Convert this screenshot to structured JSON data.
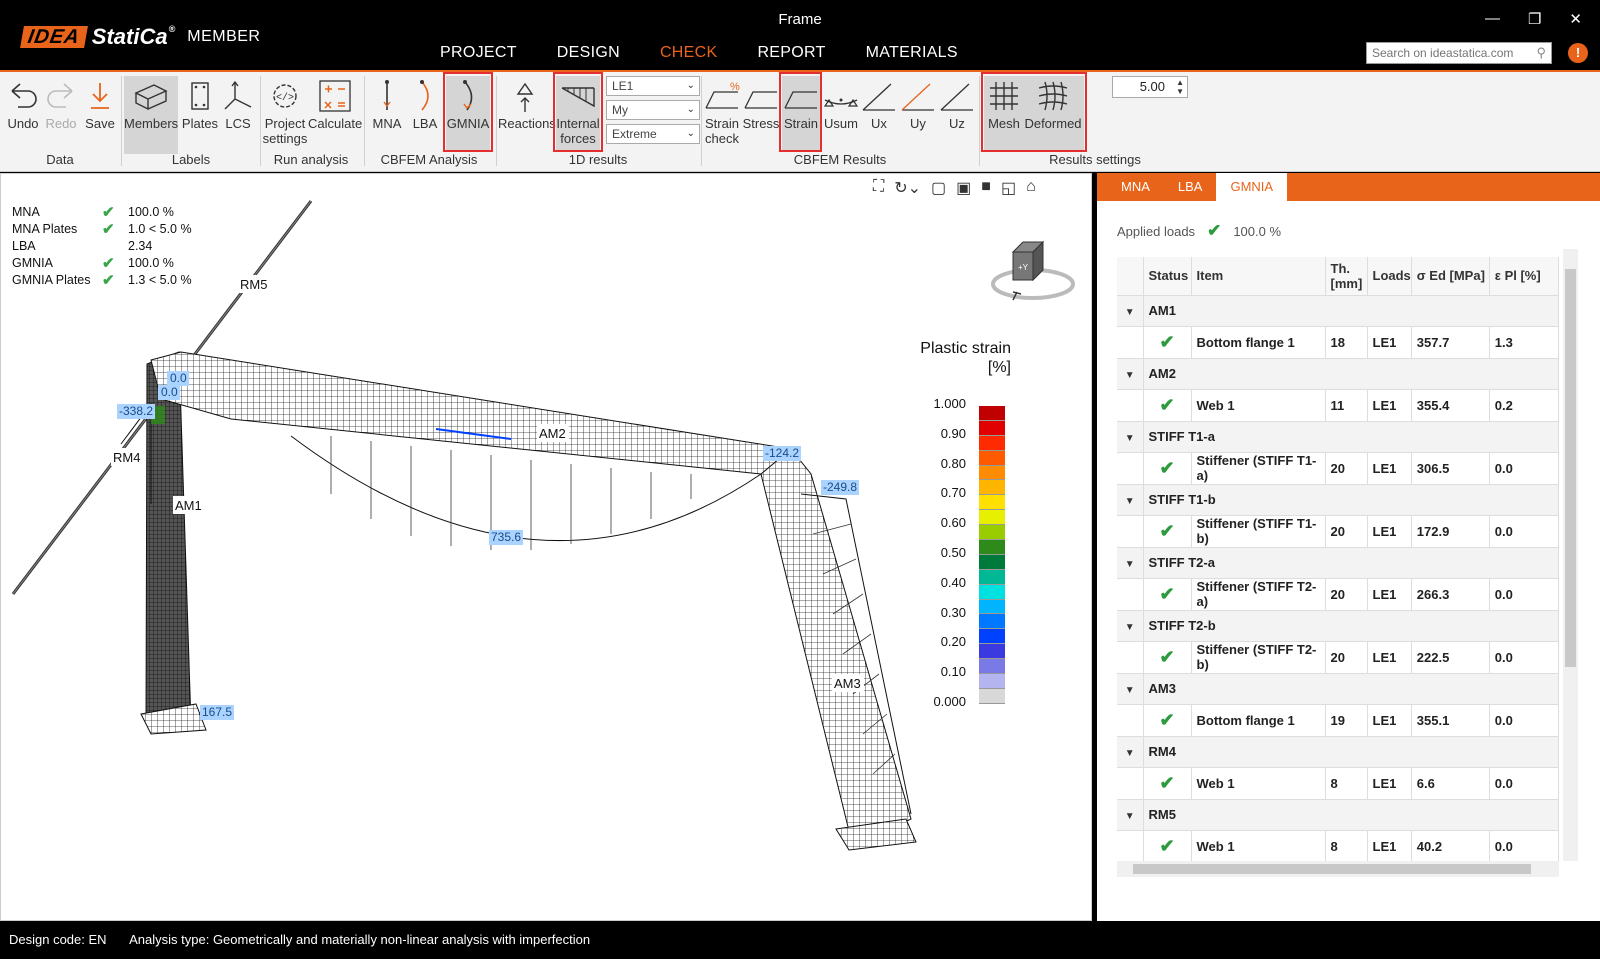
{
  "window": {
    "title": "Frame",
    "controls": [
      "—",
      "❐",
      "✕"
    ]
  },
  "logo": {
    "brand_box": "IDEA",
    "brand_name": "StatiCa",
    "reg": "®",
    "product": "MEMBER"
  },
  "menu": [
    {
      "label": "PROJECT",
      "active": false
    },
    {
      "label": "DESIGN",
      "active": false
    },
    {
      "label": "CHECK",
      "active": true
    },
    {
      "label": "REPORT",
      "active": false
    },
    {
      "label": "MATERIALS",
      "active": false
    }
  ],
  "search": {
    "placeholder": "Search on ideastatica.com"
  },
  "help": "!",
  "ribbon": {
    "undo": "Undo",
    "redo": "Redo",
    "save": "Save",
    "members": "Members",
    "plates": "Plates",
    "lcs": "LCS",
    "project_settings_1": "Project",
    "project_settings_2": "settings",
    "calculate": "Calculate",
    "mna": "MNA",
    "lba": "LBA",
    "gmnia": "GMNIA",
    "reactions": "Reactions",
    "internal_forces_1": "Internal",
    "internal_forces_2": "forces",
    "combo_loadcase": "LE1",
    "combo_force": "My",
    "combo_extreme": "Extreme",
    "strain_check_1": "Strain",
    "strain_check_2": "check",
    "stress": "Stress",
    "strain": "Strain",
    "usum": "Usum",
    "ux": "Ux",
    "uy": "Uy",
    "uz": "Uz",
    "mesh": "Mesh",
    "deformed": "Deformed",
    "scale_value": "5.00",
    "groups": {
      "data": "Data",
      "labels": "Labels",
      "run_analysis": "Run analysis",
      "cbfem_analysis": "CBFEM Analysis",
      "results_1d": "1D results",
      "cbfem_results": "CBFEM Results",
      "results_settings": "Results settings"
    }
  },
  "summary": [
    {
      "name": "MNA",
      "check": true,
      "value": "100.0 %"
    },
    {
      "name": "MNA Plates",
      "check": true,
      "value": "1.0 < 5.0 %"
    },
    {
      "name": "LBA",
      "check": false,
      "value": "2.34"
    },
    {
      "name": "GMNIA",
      "check": true,
      "value": "100.0 %"
    },
    {
      "name": "GMNIA Plates",
      "check": true,
      "value": "1.3 < 5.0 %"
    }
  ],
  "model_labels": {
    "rm5": "RM5",
    "rm4": "RM4",
    "am1": "AM1",
    "am2": "AM2",
    "am3": "AM3",
    "v_00a": "0.0",
    "v_00b": "0.0",
    "v_neg338": "-338.2",
    "v_neg124": "-124.2",
    "v_neg249": "-249.8",
    "v_735": "735.6",
    "v_167": "167.5"
  },
  "navcube": {
    "face_label": "+Y"
  },
  "legend": {
    "title_1": "Plastic strain",
    "title_2": "[%]",
    "ticks": [
      "1.000",
      "0.90",
      "0.80",
      "0.70",
      "0.60",
      "0.50",
      "0.40",
      "0.30",
      "0.20",
      "0.10",
      "0.000"
    ],
    "colors": [
      "#c00000",
      "#e00000",
      "#ff2a00",
      "#ff5a00",
      "#ff8c00",
      "#ffb400",
      "#ffe000",
      "#e6f000",
      "#9acd00",
      "#2e8b1a",
      "#007a3a",
      "#00b894",
      "#00e0e0",
      "#00b4ff",
      "#0078ff",
      "#0040ff",
      "#3a3ae0",
      "#7a7ae6",
      "#b4b4f0",
      "#d8d8d8"
    ]
  },
  "panel": {
    "tabs": [
      {
        "label": "MNA",
        "active": false
      },
      {
        "label": "LBA",
        "active": false
      },
      {
        "label": "GMNIA",
        "active": true
      }
    ],
    "applied_loads_label": "Applied loads",
    "applied_loads_value": "100.0 %",
    "columns": [
      "Status",
      "Item",
      "Th. [mm]",
      "Loads",
      "σ Ed [MPa]",
      "ε Pl [%]"
    ],
    "groups": [
      {
        "name": "AM1",
        "item": "Bottom flange 1",
        "th": "18",
        "loads": "LE1",
        "sigma": "357.7",
        "eps": "1.3"
      },
      {
        "name": "AM2",
        "item": "Web 1",
        "th": "11",
        "loads": "LE1",
        "sigma": "355.4",
        "eps": "0.2"
      },
      {
        "name": "STIFF T1-a",
        "item": "Stiffener (STIFF T1-a)",
        "th": "20",
        "loads": "LE1",
        "sigma": "306.5",
        "eps": "0.0"
      },
      {
        "name": "STIFF T1-b",
        "item": "Stiffener (STIFF T1-b)",
        "th": "20",
        "loads": "LE1",
        "sigma": "172.9",
        "eps": "0.0"
      },
      {
        "name": "STIFF T2-a",
        "item": "Stiffener (STIFF T2-a)",
        "th": "20",
        "loads": "LE1",
        "sigma": "266.3",
        "eps": "0.0"
      },
      {
        "name": "STIFF T2-b",
        "item": "Stiffener (STIFF T2-b)",
        "th": "20",
        "loads": "LE1",
        "sigma": "222.5",
        "eps": "0.0"
      },
      {
        "name": "AM3",
        "item": "Bottom flange 1",
        "th": "19",
        "loads": "LE1",
        "sigma": "355.1",
        "eps": "0.0"
      },
      {
        "name": "RM4",
        "item": "Web 1",
        "th": "8",
        "loads": "LE1",
        "sigma": "6.6",
        "eps": "0.0"
      },
      {
        "name": "RM5",
        "item": "Web 1",
        "th": "8",
        "loads": "LE1",
        "sigma": "40.2",
        "eps": "0.0"
      }
    ]
  },
  "status": {
    "design_code_label": "Design code:",
    "design_code_value": "EN",
    "analysis_type_label": "Analysis type:",
    "analysis_type_value": "Geometrically and materially non-linear analysis with imperfection"
  }
}
